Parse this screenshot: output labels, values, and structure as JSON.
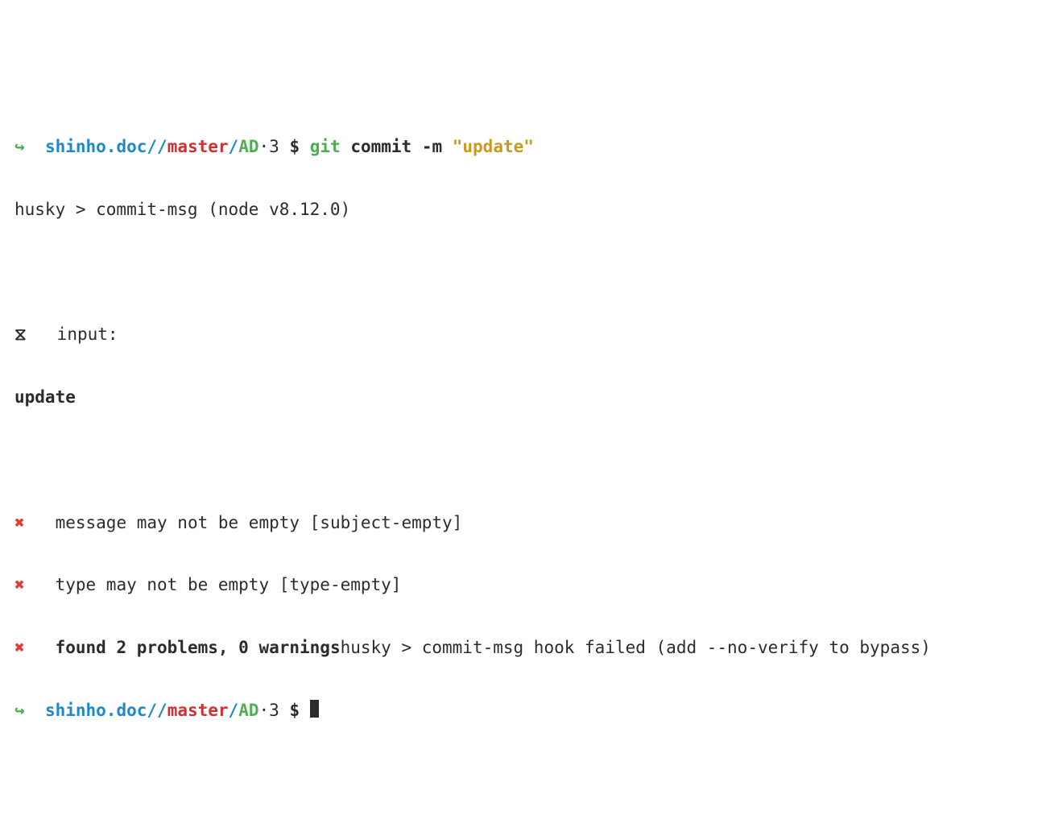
{
  "prompt1": {
    "arrow": "↪",
    "path": "shinho.doc/",
    "slash": "/",
    "branch": "master",
    "slash2": "/",
    "state": "AD",
    "dotnum": "·3",
    "dollar": " $ ",
    "git": "git",
    "args": " commit -m ",
    "msgstr": "\"update\""
  },
  "husky_line": "husky > commit-msg (node v8.12.0)",
  "input_icon": "⧖",
  "input_label": "   input:",
  "input_value": "update",
  "err1_icon": "✖",
  "err1_text": "   message may not be empty [subject-empty]",
  "err2_icon": "✖",
  "err2_text": "   type may not be empty [type-empty]",
  "summary_icon": "✖",
  "summary_bold": "   found 2 problems, 0 warnings",
  "summary_tail": "husky > commit-msg hook failed (add --no-verify to bypass)",
  "prompt2": {
    "arrow": "↪",
    "path": "shinho.doc/",
    "slash": "/",
    "branch": "master",
    "slash2": "/",
    "state": "AD",
    "dotnum": "·3",
    "dollar": " $ "
  }
}
